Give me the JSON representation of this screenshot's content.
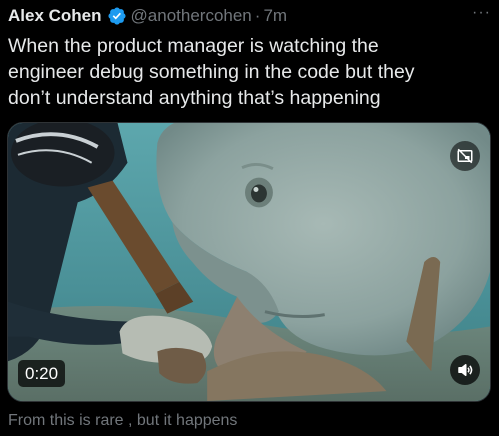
{
  "author": {
    "name": "Alex Cohen",
    "handle": "@anothercohen",
    "separator": "·",
    "time": "7m",
    "verified_color": "#1d9bf0"
  },
  "more_label": "···",
  "tweet": {
    "line1": "When the product manager is watching the",
    "line2": "engineer debug something in the code but they",
    "line3": "don’t understand anything that’s happening"
  },
  "media": {
    "duration": "0:20",
    "volume_icon": "speaker-icon",
    "pip_icon": "picture-in-picture-off-icon"
  },
  "caption": "From this is rare , but it happens",
  "colors": {
    "background": "#000000",
    "text": "#e7e9ea",
    "secondary_text": "#71767b",
    "accent": "#1d9bf0"
  }
}
